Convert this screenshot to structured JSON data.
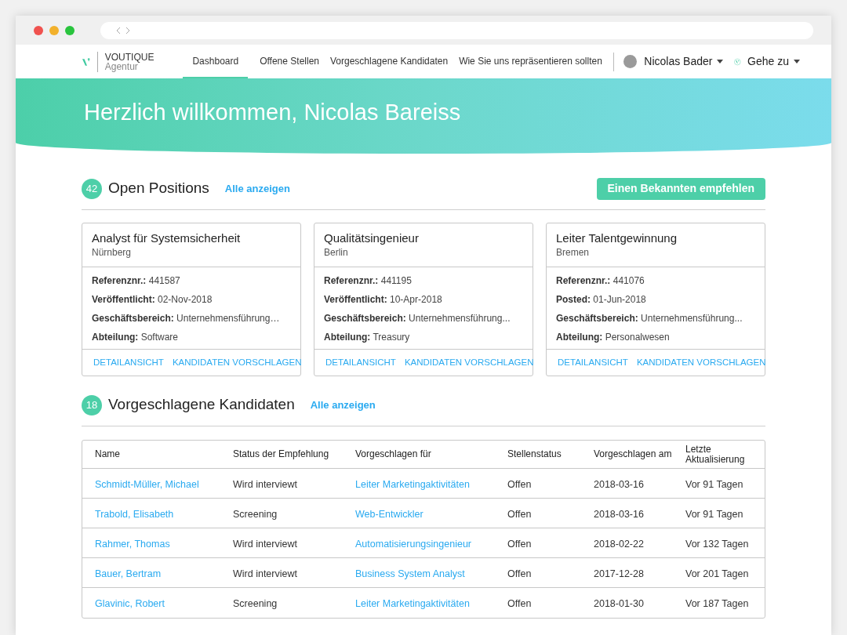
{
  "brand": {
    "name": "VOUTIQUE",
    "sub": "Agentur"
  },
  "nav": [
    {
      "label": "Dashboard",
      "selected": true
    },
    {
      "label": "Offene Stellen",
      "selected": false
    },
    {
      "label": "Vorgeschlagene Kandidaten",
      "selected": false
    },
    {
      "label": "Wie Sie uns repräsentieren sollten",
      "selected": false
    }
  ],
  "user": {
    "name": "Nicolas Bader"
  },
  "goto": {
    "label": "Gehe zu"
  },
  "banner": {
    "title": "Herzlich willkommen, Nicolas Bareiss"
  },
  "positions": {
    "count": "42",
    "title": "Open Positions",
    "link": "Alle anzeigen",
    "button": "Einen Bekannten empfehlen",
    "cards": [
      {
        "title": "Analyst für Systemsicherheit",
        "city": "Nürnberg",
        "fields": [
          {
            "label": "Referenznr.:",
            "value": "441587"
          },
          {
            "label": "Veröffentlicht:",
            "value": "02-Nov-2018"
          },
          {
            "label": "Geschäftsbereich:",
            "value": "Unternehmensführung…"
          },
          {
            "label": "Abteilung:",
            "value": "Software"
          }
        ],
        "actions": [
          "DETAILANSICHT",
          "KANDIDATEN VORSCHLAGEN"
        ]
      },
      {
        "title": "Qualitätsingenieur",
        "city": "Berlin",
        "fields": [
          {
            "label": "Referenznr.:",
            "value": "441195"
          },
          {
            "label": "Veröffentlicht:",
            "value": "10-Apr-2018"
          },
          {
            "label": "Geschäftsbereich:",
            "value": "Unternehmensführung..."
          },
          {
            "label": "Abteilung:",
            "value": "Treasury"
          }
        ],
        "actions": [
          "DETAILANSICHT",
          "KANDIDATEN VORSCHLAGEN"
        ]
      },
      {
        "title": "Leiter Talentgewinnung",
        "city": "Bremen",
        "fields": [
          {
            "label": "Referenznr.:",
            "value": "441076"
          },
          {
            "label": "Posted:",
            "value": "01-Jun-2018"
          },
          {
            "label": "Geschäftsbereich:",
            "value": "Unternehmensführung..."
          },
          {
            "label": "Abteilung:",
            "value": "Personalwesen"
          }
        ],
        "actions": [
          "DETAILANSICHT",
          "KANDIDATEN VORSCHLAGEN"
        ]
      }
    ]
  },
  "candidates": {
    "count": "18",
    "title": "Vorgeschlagene Kandidaten",
    "link": "Alle anzeigen",
    "table": {
      "columns": [
        "Name",
        "Status der Empfehlung",
        "Vorgeschlagen für",
        "Stellenstatus",
        "Vorgeschlagen am",
        "Letzte Aktualisierung"
      ],
      "rows": [
        [
          "Schmidt-Müller, Michael",
          "Wird interviewt",
          "Leiter Marketingaktivitäten",
          "Offen",
          "2018-03-16",
          "Vor 91 Tagen"
        ],
        [
          "Trabold, Elisabeth",
          "Screening",
          "Web-Entwickler",
          "Offen",
          "2018-03-16",
          "Vor 91 Tagen"
        ],
        [
          "Rahmer, Thomas",
          "Wird interviewt",
          "Automatisierungsingenieur",
          "Offen",
          "2018-02-22",
          "Vor 132 Tagen"
        ],
        [
          "Bauer, Bertram",
          "Wird interviewt",
          "Business System Analyst",
          "Offen",
          "2017-12-28",
          "Vor 201 Tagen"
        ],
        [
          "Glavinic, Robert",
          "Screening",
          "Leiter Marketingaktivitäten",
          "Offen",
          "2018-01-30",
          "Vor 187 Tagen"
        ]
      ]
    }
  }
}
